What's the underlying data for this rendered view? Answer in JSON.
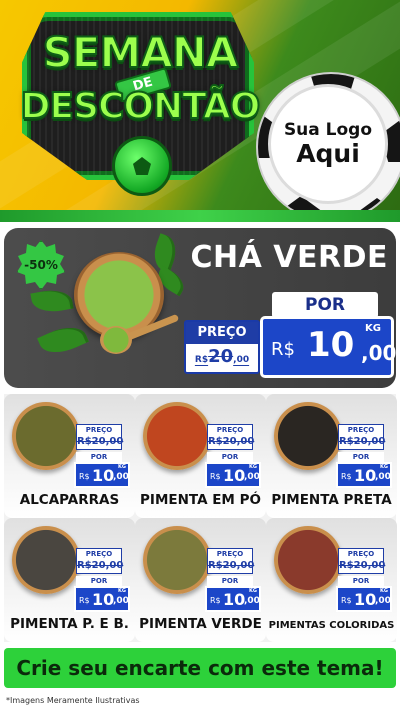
{
  "header": {
    "title_line1": "SEMANA",
    "title_tag": "DE",
    "title_line2": "DESCONTÃO",
    "logo_line1": "Sua Logo",
    "logo_line2": "Aqui"
  },
  "featured": {
    "discount_badge": "-50%",
    "name": "CHÁ VERDE",
    "old_price_label": "PREÇO",
    "old_price_currency": "R$",
    "old_price_int": "20",
    "old_price_dec": ",00",
    "new_price_label": "POR",
    "new_price_currency": "R$",
    "new_price_int": "10",
    "new_price_dec": ",00",
    "unit": "KG"
  },
  "products": [
    {
      "name": "ALCAPARRAS",
      "old_price": "R$20,00",
      "preco_label": "PREÇO",
      "por_label": "POR",
      "currency": "R$",
      "price_int": "10",
      "price_dec": ",00",
      "unit": "KG",
      "color": "#6b6b2e"
    },
    {
      "name": "PIMENTA EM PÓ",
      "old_price": "R$20,00",
      "preco_label": "PREÇO",
      "por_label": "POR",
      "currency": "R$",
      "price_int": "10",
      "price_dec": ",00",
      "unit": "KG",
      "color": "#c0461f"
    },
    {
      "name": "PIMENTA PRETA",
      "old_price": "R$20,00",
      "preco_label": "PREÇO",
      "por_label": "POR",
      "currency": "R$",
      "price_int": "10",
      "price_dec": ",00",
      "unit": "KG",
      "color": "#2a2622"
    },
    {
      "name": "PIMENTA P. E B.",
      "old_price": "R$20,00",
      "preco_label": "PREÇO",
      "por_label": "POR",
      "currency": "R$",
      "price_int": "10",
      "price_dec": ",00",
      "unit": "KG",
      "color": "#4a4640"
    },
    {
      "name": "PIMENTA VERDE",
      "old_price": "R$20,00",
      "preco_label": "PREÇO",
      "por_label": "POR",
      "currency": "R$",
      "price_int": "10",
      "price_dec": ",00",
      "unit": "KG",
      "color": "#7c7a3c"
    },
    {
      "name": "PIMENTAS COLORIDAS",
      "old_price": "R$20,00",
      "preco_label": "PREÇO",
      "por_label": "POR",
      "currency": "R$",
      "price_int": "10",
      "price_dec": ",00",
      "unit": "KG",
      "color": "#8a3a2c"
    }
  ],
  "footer": {
    "cta": "Crie seu encarte com este tema!",
    "disclaimer": "*Imagens Meramente Ilustrativas"
  },
  "colors": {
    "accent_green": "#2dd13a",
    "price_blue": "#1c46c8",
    "header_yellow": "#f6c800",
    "feature_dark": "#454545"
  }
}
